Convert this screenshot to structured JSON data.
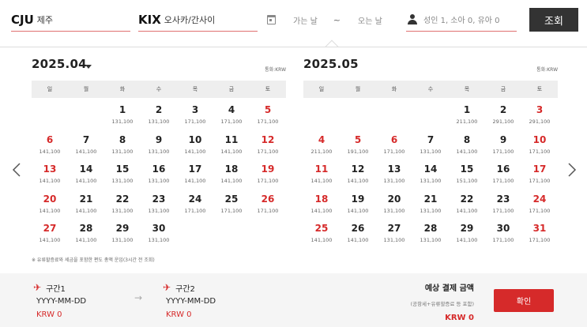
{
  "search": {
    "origin": {
      "code": "CJU",
      "city": "제주"
    },
    "destination": {
      "code": "KIX",
      "city": "오사카/간사이"
    },
    "depart_placeholder": "가는 날",
    "date_separator": "~",
    "return_placeholder": "오는 날",
    "passengers": "성인 1, 소아 0, 유아 0",
    "search_label": "조회"
  },
  "weekdays": [
    "일",
    "월",
    "화",
    "수",
    "목",
    "금",
    "토"
  ],
  "months": [
    {
      "title": "2025.04",
      "currency": "통화:KRW",
      "offset": 2,
      "days": [
        {
          "d": "1",
          "p": "131,100"
        },
        {
          "d": "2",
          "p": "131,100"
        },
        {
          "d": "3",
          "p": "171,100"
        },
        {
          "d": "4",
          "p": "171,100"
        },
        {
          "d": "5",
          "p": "171,100",
          "hol": true
        },
        {
          "d": "6",
          "p": "141,100",
          "hol": true
        },
        {
          "d": "7",
          "p": "141,100"
        },
        {
          "d": "8",
          "p": "131,100"
        },
        {
          "d": "9",
          "p": "131,100"
        },
        {
          "d": "10",
          "p": "141,100"
        },
        {
          "d": "11",
          "p": "141,100"
        },
        {
          "d": "12",
          "p": "171,100",
          "hol": true
        },
        {
          "d": "13",
          "p": "141,100",
          "hol": true
        },
        {
          "d": "14",
          "p": "141,100"
        },
        {
          "d": "15",
          "p": "131,100"
        },
        {
          "d": "16",
          "p": "131,100"
        },
        {
          "d": "17",
          "p": "141,100"
        },
        {
          "d": "18",
          "p": "141,100"
        },
        {
          "d": "19",
          "p": "171,100",
          "hol": true
        },
        {
          "d": "20",
          "p": "141,100",
          "hol": true
        },
        {
          "d": "21",
          "p": "141,100"
        },
        {
          "d": "22",
          "p": "131,100"
        },
        {
          "d": "23",
          "p": "131,100"
        },
        {
          "d": "24",
          "p": "171,100"
        },
        {
          "d": "25",
          "p": "171,100"
        },
        {
          "d": "26",
          "p": "171,100",
          "hol": true
        },
        {
          "d": "27",
          "p": "141,100",
          "hol": true
        },
        {
          "d": "28",
          "p": "141,100"
        },
        {
          "d": "29",
          "p": "131,100"
        },
        {
          "d": "30",
          "p": "131,100"
        }
      ]
    },
    {
      "title": "2025.05",
      "currency": "통화:KRW",
      "offset": 4,
      "days": [
        {
          "d": "1",
          "p": "211,100"
        },
        {
          "d": "2",
          "p": "291,100"
        },
        {
          "d": "3",
          "p": "291,100",
          "hol": true
        },
        {
          "d": "4",
          "p": "211,100",
          "hol": true
        },
        {
          "d": "5",
          "p": "191,100",
          "hol": true
        },
        {
          "d": "6",
          "p": "171,100",
          "hol": true
        },
        {
          "d": "7",
          "p": "131,100"
        },
        {
          "d": "8",
          "p": "141,100"
        },
        {
          "d": "9",
          "p": "171,100"
        },
        {
          "d": "10",
          "p": "171,100",
          "hol": true
        },
        {
          "d": "11",
          "p": "141,100",
          "hol": true
        },
        {
          "d": "12",
          "p": "141,100"
        },
        {
          "d": "13",
          "p": "131,100"
        },
        {
          "d": "14",
          "p": "131,100"
        },
        {
          "d": "15",
          "p": "151,100"
        },
        {
          "d": "16",
          "p": "171,100"
        },
        {
          "d": "17",
          "p": "171,100",
          "hol": true
        },
        {
          "d": "18",
          "p": "141,100",
          "hol": true
        },
        {
          "d": "19",
          "p": "141,100"
        },
        {
          "d": "20",
          "p": "131,100"
        },
        {
          "d": "21",
          "p": "131,100"
        },
        {
          "d": "22",
          "p": "141,100"
        },
        {
          "d": "23",
          "p": "171,100"
        },
        {
          "d": "24",
          "p": "171,100",
          "hol": true
        },
        {
          "d": "25",
          "p": "141,100",
          "hol": true
        },
        {
          "d": "26",
          "p": "141,100"
        },
        {
          "d": "27",
          "p": "131,100"
        },
        {
          "d": "28",
          "p": "131,100"
        },
        {
          "d": "29",
          "p": "141,100"
        },
        {
          "d": "30",
          "p": "171,100"
        },
        {
          "d": "31",
          "p": "171,100",
          "hol": true
        }
      ]
    }
  ],
  "footnote": "※ 유류할증료와 세금을 포함한 편도 총액 운임(3시간 전 조회)",
  "summary": {
    "segment1": {
      "label": "구간1",
      "date": "YYYY-MM-DD",
      "price": "KRW 0"
    },
    "arrow": "→",
    "segment2": {
      "label": "구간2",
      "date": "YYYY-MM-DD",
      "price": "KRW 0"
    },
    "total_title": "예상 결제 금액",
    "total_sub": "(공항세+유류할증료 등 포함)",
    "total_price": "KRW 0",
    "confirm_label": "확인"
  },
  "colors": {
    "accent": "#d62a2a",
    "dark_button": "#333333"
  }
}
